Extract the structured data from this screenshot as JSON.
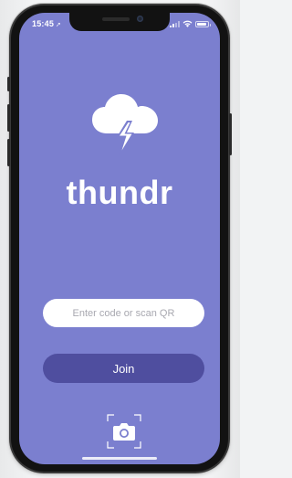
{
  "status_bar": {
    "time": "15:45",
    "location_arrow": "location-arrow-icon",
    "signal_icon": "signal-bars-icon",
    "wifi_icon": "wifi-icon",
    "battery_icon": "battery-icon"
  },
  "app": {
    "logo_icon": "cloud-lightning-icon",
    "name": "thundr"
  },
  "join_form": {
    "code_input_placeholder": "Enter code or scan QR",
    "code_input_value": "",
    "join_label": "Join",
    "scan_icon": "camera-scan-icon"
  },
  "colors": {
    "background": "#7b7fcf",
    "button": "#4f4e9f",
    "input_bg": "#ffffff",
    "text": "#ffffff"
  }
}
